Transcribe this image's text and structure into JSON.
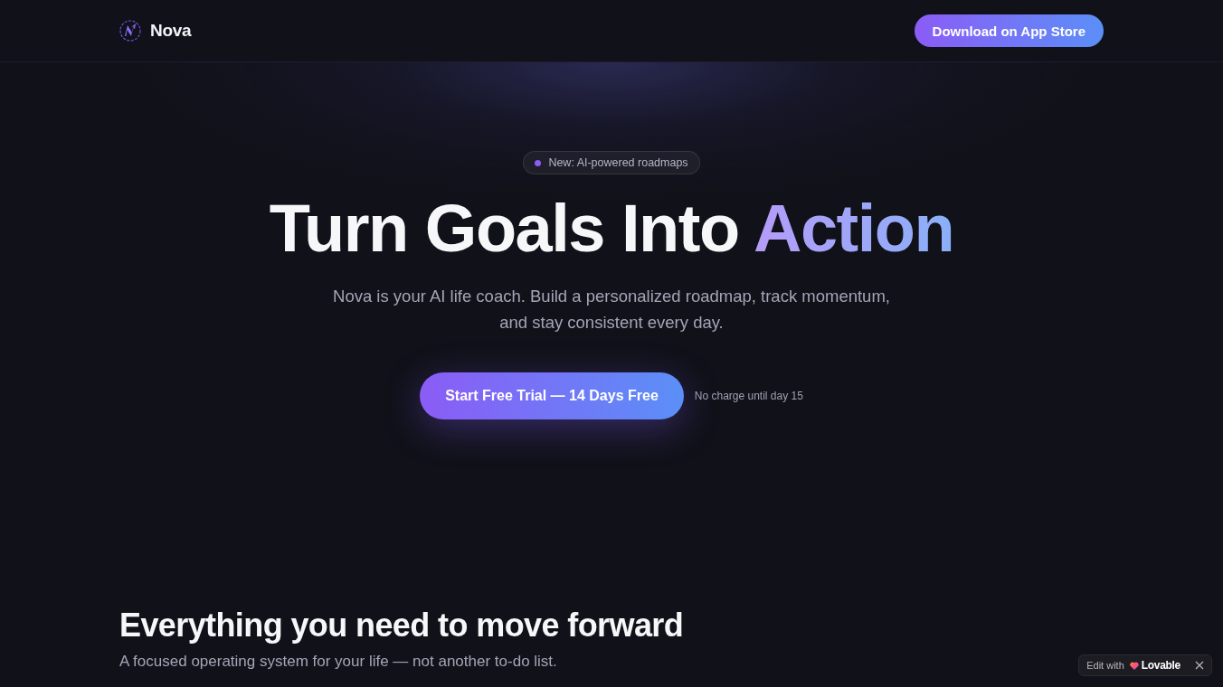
{
  "nav": {
    "brand": "Nova",
    "cta": "Download on App Store"
  },
  "hero": {
    "badge": "New: AI-powered roadmaps",
    "title": "Turn Goals Into",
    "title_highlight": "Action",
    "subtitle": "Nova is your AI life coach. Build a personalized roadmap, track momentum, and stay consistent every day.",
    "cta": "Start Free Trial — 14 Days Free",
    "cta_note": "No charge until day 15"
  },
  "features": {
    "title": "Everything you need to move forward",
    "subtitle": "A focused operating system for your life — not another to-do list."
  },
  "edit_badge": {
    "label": "Edit with",
    "brand": "Lovable"
  }
}
